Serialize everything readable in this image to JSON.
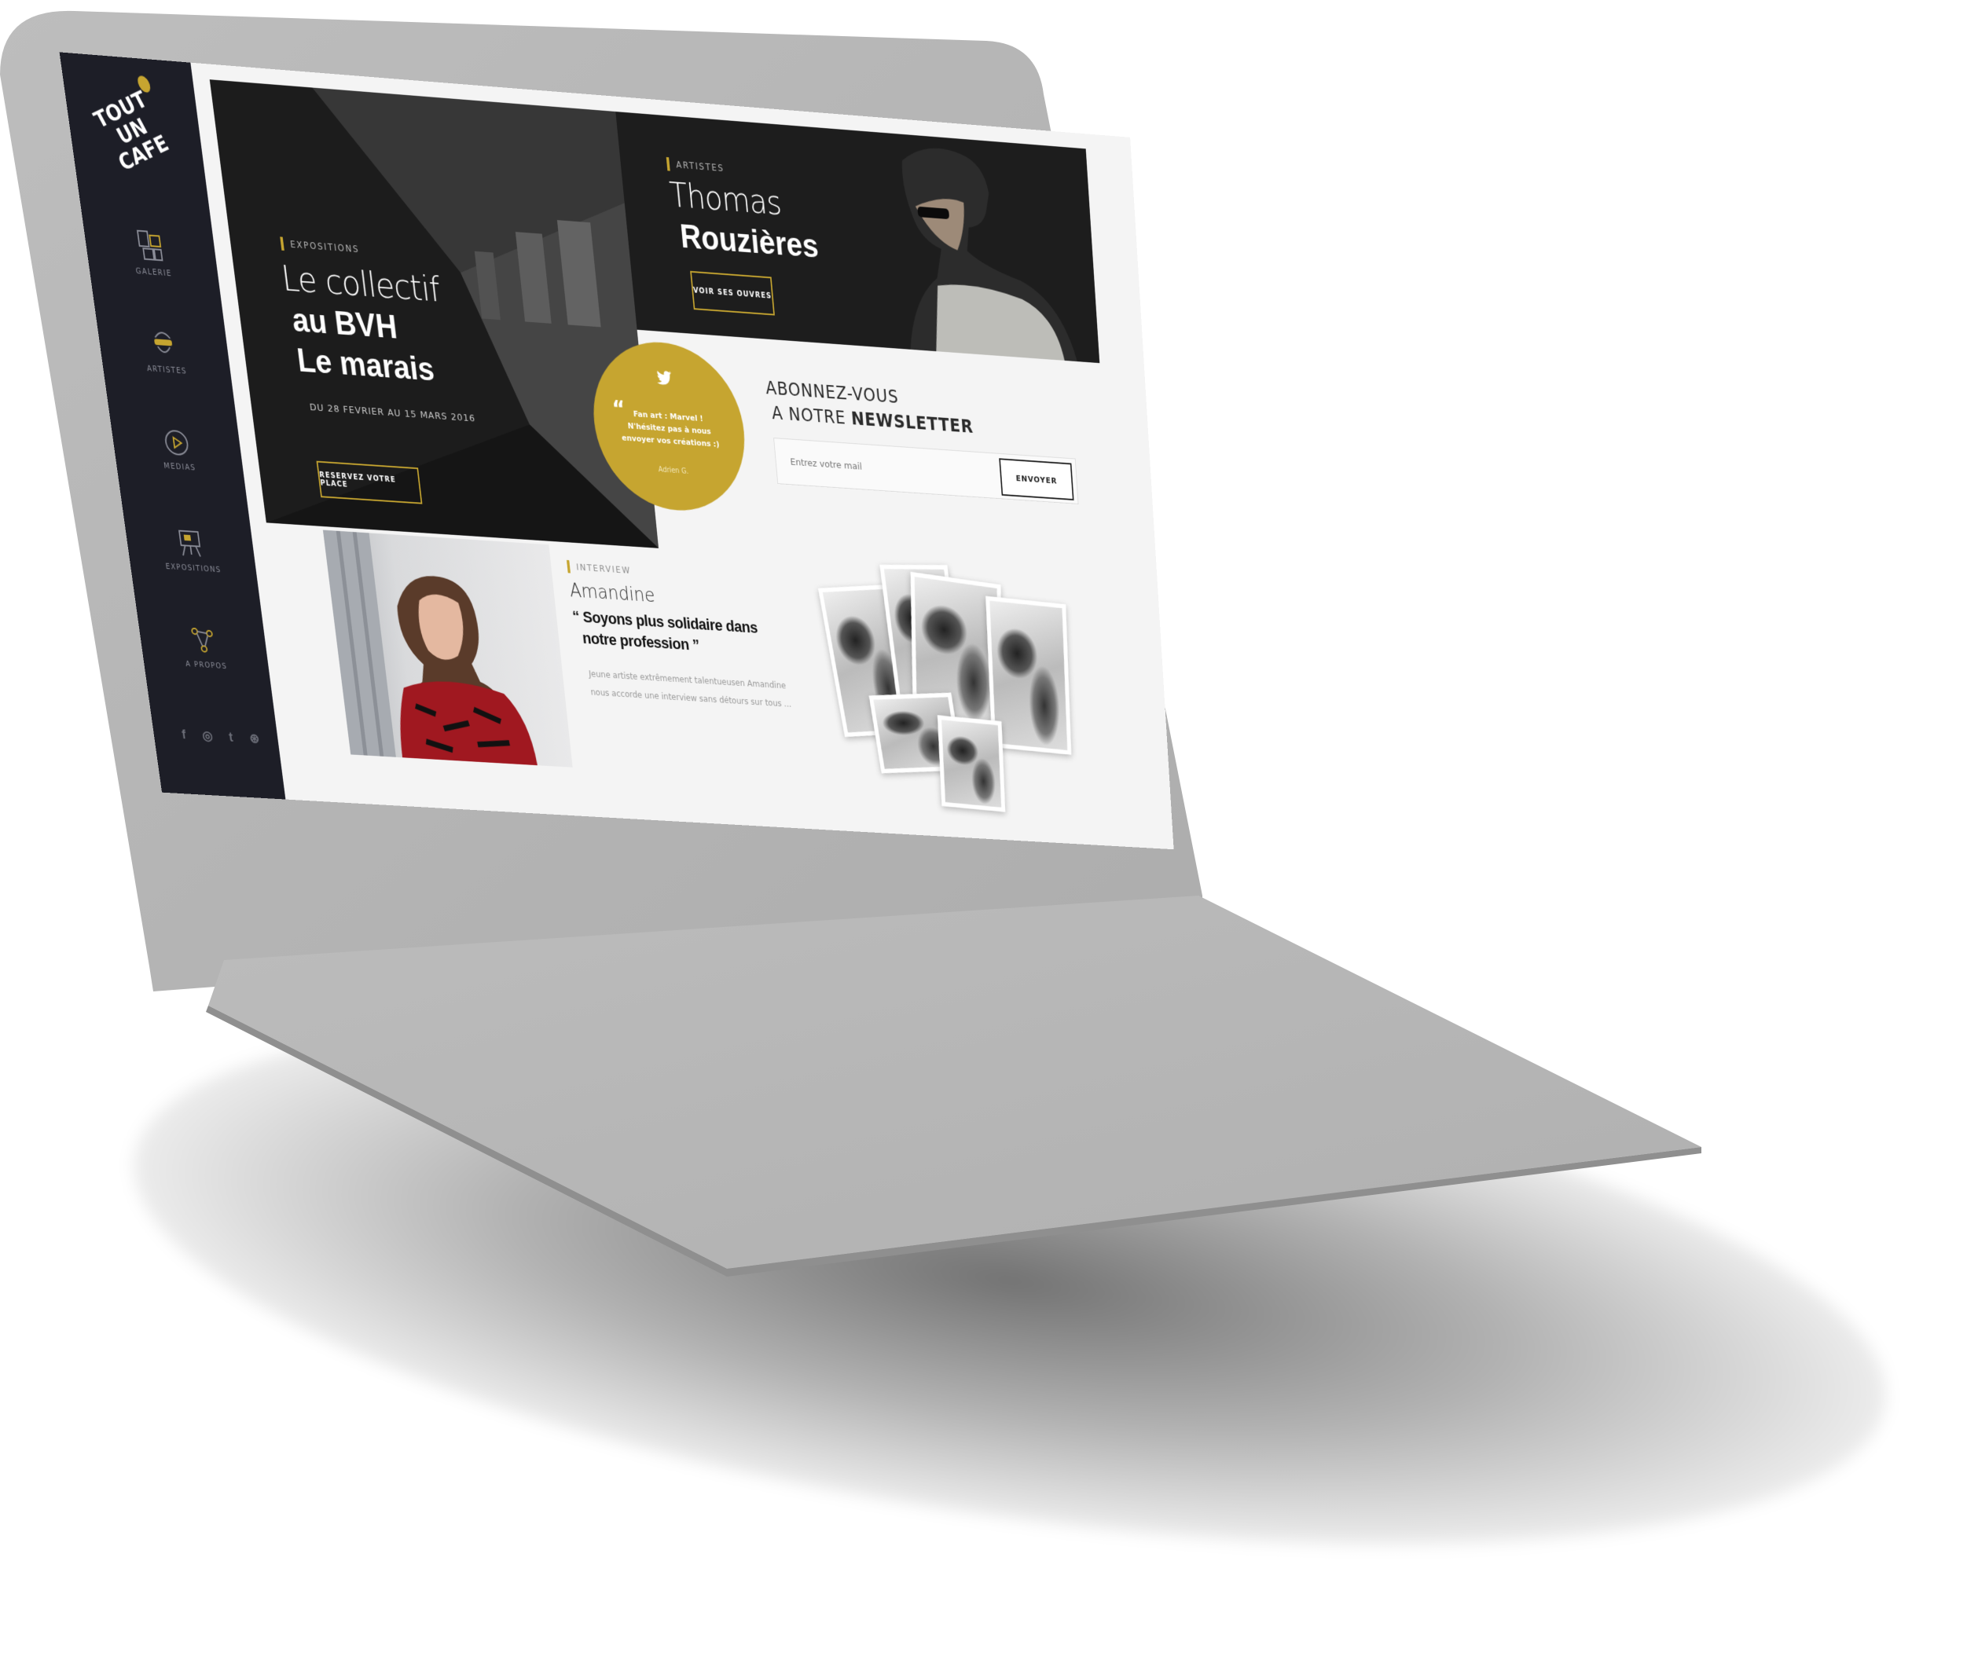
{
  "colors": {
    "accent": "#c6a530",
    "sidebar": "#1d1e27",
    "screen_bg": "#f4f4f4",
    "device_body": "#b5b5b5"
  },
  "brand": {
    "logo_line1": "TOUT",
    "logo_line2": "UN CAFE"
  },
  "sidebar": {
    "items": [
      {
        "label": "GALERIE",
        "icon": "gallery-icon"
      },
      {
        "label": "ARTISTES",
        "icon": "artist-mask-icon"
      },
      {
        "label": "MEDIAS",
        "icon": "play-icon"
      },
      {
        "label": "EXPOSITIONS",
        "icon": "easel-icon"
      },
      {
        "label": "A PROPOS",
        "icon": "share-nodes-icon"
      }
    ],
    "socials": [
      {
        "glyph": "f",
        "icon": "facebook-icon"
      },
      {
        "glyph": "◎",
        "icon": "instagram-icon"
      },
      {
        "glyph": "t",
        "icon": "tumblr-icon"
      },
      {
        "glyph": "⊛",
        "icon": "dribbble-icon"
      }
    ]
  },
  "exhibition": {
    "tag": "EXPOSITIONS",
    "title_light": "Le collectif",
    "title_bold_1": "au BVH",
    "title_bold_2": "Le marais",
    "dates": "DU 28 FEVRIER  AU 15 MARS 2016",
    "cta": "RESERVEZ VOTRE PLACE"
  },
  "artist": {
    "tag": "ARTISTES",
    "first_name": "Thomas",
    "last_name": "Rouzières",
    "cta": "VOIR SES OUVRES"
  },
  "tweet": {
    "icon": "twitter-icon",
    "quote_mark": "“",
    "line1": "Fan art : Marvel !",
    "line2": "N'hésitez pas à nous",
    "line3": "envoyer vos créations :)",
    "author": "Adrien G."
  },
  "newsletter": {
    "line1": "ABONNEZ-VOUS",
    "line2_prefix": "A NOTRE ",
    "line2_bold": "NEWSLETTER",
    "placeholder": "Entrez votre mail",
    "button": "ENVOYER"
  },
  "interview": {
    "tag": "INTERVIEW",
    "name": "Amandine",
    "quote_line1": "“ Soyons plus solidaire dans",
    "quote_line2": "notre profession ”",
    "excerpt_line1": "Jeune artiste extrêmement talentueusen Amandine",
    "excerpt_line2": "nous accorde une interview sans détours sur tous ..."
  }
}
